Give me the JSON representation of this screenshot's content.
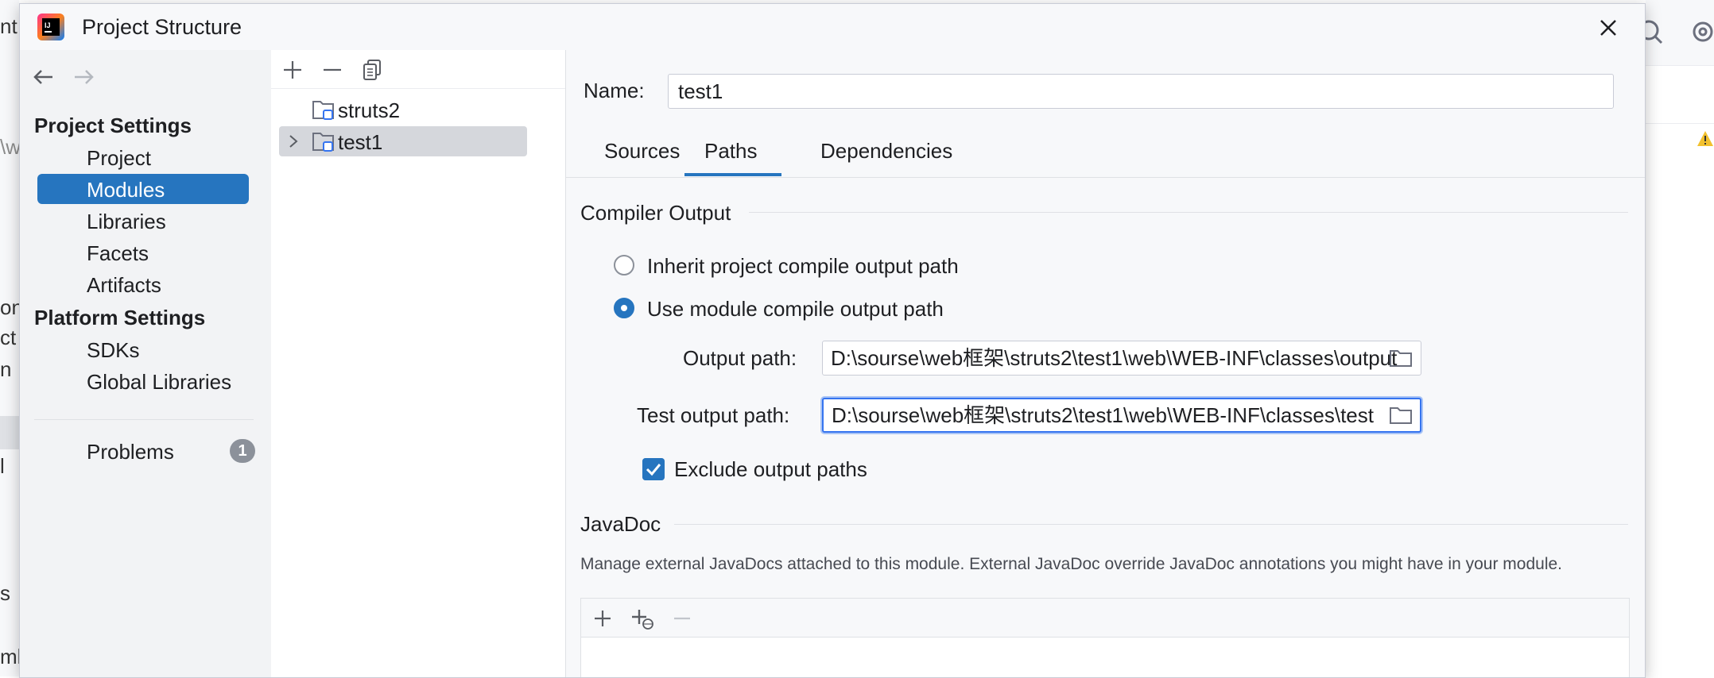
{
  "background": {
    "left_fragments": [
      "nt",
      "\\w",
      "on",
      "ct",
      "n",
      "l",
      "s",
      "ml"
    ]
  },
  "dialog": {
    "title": "Project Structure"
  },
  "nav": {
    "sections": [
      {
        "header": "Project Settings",
        "items": [
          "Project",
          "Modules",
          "Libraries",
          "Facets",
          "Artifacts"
        ]
      },
      {
        "header": "Platform Settings",
        "items": [
          "SDKs",
          "Global Libraries"
        ]
      }
    ],
    "selected": "Modules",
    "problems_label": "Problems",
    "problems_count": "1"
  },
  "modules": {
    "items": [
      {
        "name": "struts2",
        "expandable": false,
        "selected": false
      },
      {
        "name": "test1",
        "expandable": true,
        "selected": true
      }
    ]
  },
  "details": {
    "name_label": "Name:",
    "name_value": "test1",
    "tabs": [
      "Sources",
      "Paths",
      "Dependencies"
    ],
    "active_tab": "Paths",
    "compiler_output": {
      "title": "Compiler Output",
      "option_inherit": "Inherit project compile output path",
      "option_use_module": "Use module compile output path",
      "selected_option": "option_use_module",
      "output_path_label": "Output path:",
      "output_path_value": "D:\\sourse\\web框架\\struts2\\test1\\web\\WEB-INF\\classes\\output",
      "test_output_path_label": "Test output path:",
      "test_output_path_value": "D:\\sourse\\web框架\\struts2\\test1\\web\\WEB-INF\\classes\\test",
      "exclude_label": "Exclude output paths",
      "exclude_checked": true
    },
    "javadoc": {
      "title": "JavaDoc",
      "description": "Manage external JavaDocs attached to this module. External JavaDoc override JavaDoc annotations you might have in your module."
    }
  },
  "colors": {
    "accent": "#2675bf",
    "focus": "#3574f0",
    "badge": "#8c919a"
  }
}
